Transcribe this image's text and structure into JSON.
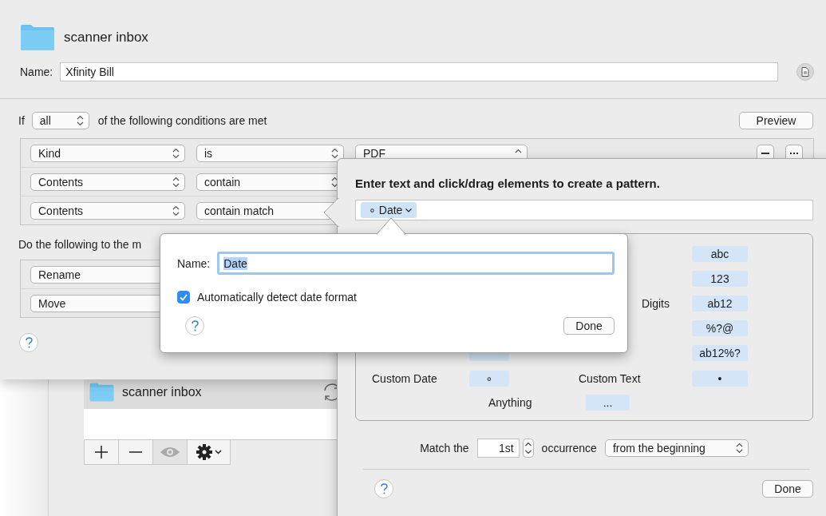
{
  "back_window": {
    "folder": "scanner inbox"
  },
  "rule_sheet": {
    "folder": "scanner inbox",
    "name_label": "Name:",
    "name_value": "Xfinity Bill",
    "if_label": "If",
    "match_mode": "all",
    "conditions_text": "of the following conditions are met",
    "preview_button": "Preview",
    "conditions": [
      {
        "attribute": "Kind",
        "operator": "is",
        "value": "PDF",
        "row_buttons": true,
        "operator_arrows": true
      },
      {
        "attribute": "Contents",
        "operator": "contain",
        "operator_arrows": true
      },
      {
        "attribute": "Contents",
        "operator": "contain match"
      }
    ],
    "actions_text": "Do the following to the m",
    "actions": [
      {
        "label": "Rename"
      },
      {
        "label": "Move"
      }
    ]
  },
  "pattern_popover": {
    "instruction": "Enter text and click/drag elements to create a pattern.",
    "token": {
      "symbol": "∘",
      "label": "Date"
    },
    "elements_left": [
      {
        "kind": "full"
      },
      {
        "kind": "full",
        "label": "Custom Date",
        "token": "∘"
      }
    ],
    "elements_right": [
      {
        "kind": "full",
        "token": "abc"
      },
      {
        "kind": "full",
        "token": "123"
      },
      {
        "kind": "clipped",
        "label": "Digits",
        "token": "ab12"
      },
      {
        "kind": "full",
        "token": "%?@"
      },
      {
        "kind": "full",
        "token": "ab12%?"
      },
      {
        "kind": "full",
        "label": "Custom Text",
        "token": "•"
      }
    ],
    "anything": {
      "label": "Anything",
      "token": "..."
    },
    "match_label": "Match the",
    "occurrence_value": "1st",
    "occurrence_label": "occurrence",
    "direction": "from the beginning",
    "done_button": "Done"
  },
  "name_popover": {
    "name_label": "Name:",
    "name_value": "Date",
    "name_selected": true,
    "auto_detect": {
      "label": "Automatically detect date format",
      "checked": true
    },
    "done_button": "Done"
  }
}
